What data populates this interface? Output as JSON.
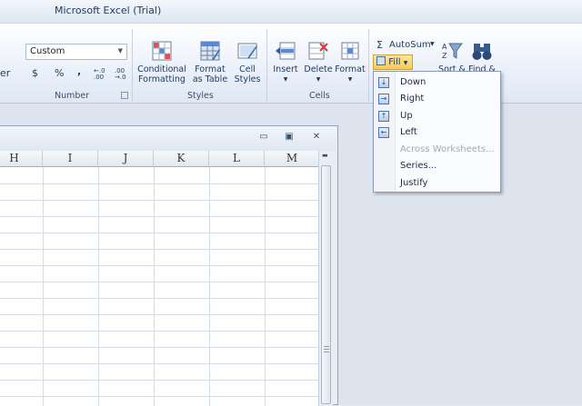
{
  "window": {
    "title": "Microsoft Excel (Trial)"
  },
  "ribbon": {
    "number_group": {
      "label": "Number",
      "format_value": "Custom",
      "partial_label": "er",
      "currency": "$",
      "percent": "%",
      "comma": ",",
      "inc_decimal": "←.0 .00",
      "dec_decimal": ".00 →.0"
    },
    "styles_group": {
      "label": "Styles",
      "conditional_formatting": {
        "line1": "Conditional",
        "line2": "Formatting"
      },
      "format_as_table": {
        "line1": "Format",
        "line2": "as Table"
      },
      "cell_styles": {
        "line1": "Cell",
        "line2": "Styles"
      }
    },
    "cells_group": {
      "label": "Cells",
      "insert": "Insert",
      "delete": "Delete",
      "format": "Format"
    },
    "editing_group": {
      "sigma": "Σ",
      "autosum": "AutoSum",
      "fill": "Fill",
      "sort_partial": "Sort &",
      "find_partial": "Find &"
    }
  },
  "fill_menu": {
    "items": [
      {
        "label": "Down",
        "icon": "arrow-down-icon",
        "glyph": "↓",
        "enabled": true
      },
      {
        "label": "Right",
        "icon": "arrow-right-icon",
        "glyph": "→",
        "enabled": true
      },
      {
        "label": "Up",
        "icon": "arrow-up-icon",
        "glyph": "↑",
        "enabled": true
      },
      {
        "label": "Left",
        "icon": "arrow-left-icon",
        "glyph": "←",
        "enabled": true
      },
      {
        "label": "Across Worksheets...",
        "enabled": false
      },
      {
        "label": "Series...",
        "enabled": true
      },
      {
        "label": "Justify",
        "enabled": true
      }
    ]
  },
  "workbook": {
    "controls": {
      "minimize": "▭",
      "restore": "▣",
      "close": "✕"
    },
    "columns": [
      "H",
      "I",
      "J",
      "K",
      "L",
      "M"
    ]
  },
  "colors": {
    "accent": "#1e395b",
    "fill_button": "#f7c95c",
    "menu_bg": "#fafbfd"
  }
}
